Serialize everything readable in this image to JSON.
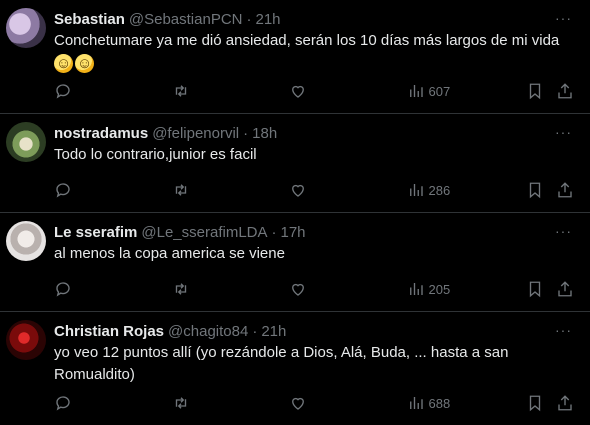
{
  "tweets": [
    {
      "name": "Sebastian",
      "handle": "@SebastianPCN",
      "time": "21h",
      "text": "Conchetumare ya me dió ansiedad, serán los 10 días más largos de mi vida",
      "emojis": [
        "grinning-face-with-tongue",
        "grinning-face-with-tongue"
      ],
      "views": "607"
    },
    {
      "name": "nostradamus",
      "handle": "@felipenorvil",
      "time": "18h",
      "text": "Todo lo contrario,junior es facil",
      "views": "286"
    },
    {
      "name": "Le sserafim",
      "handle": "@Le_sserafimLDA",
      "time": "17h",
      "text": "al menos la copa america se viene",
      "views": "205"
    },
    {
      "name": "Christian Rojas",
      "handle": "@chagito84",
      "time": "21h",
      "text": "yo veo 12 puntos allí (yo rezándole a Dios, Alá, Buda, ... hasta a san Romualdito)",
      "views": "688"
    }
  ],
  "separator": "·",
  "more_label": "···",
  "icons": [
    "reply-icon",
    "retweet-icon",
    "like-icon",
    "views-icon",
    "bookmark-icon",
    "share-icon",
    "more-icon"
  ]
}
